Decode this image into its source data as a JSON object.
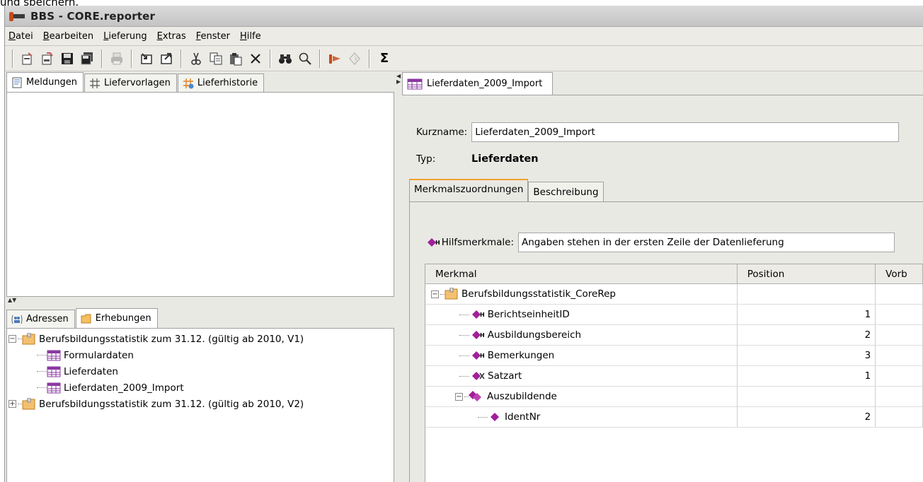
{
  "page": {
    "top_caption": "und speichern."
  },
  "window": {
    "title": "BBS - CORE.reporter"
  },
  "menu": [
    {
      "u": "D",
      "rest": "atei"
    },
    {
      "u": "B",
      "rest": "earbeiten"
    },
    {
      "u": "L",
      "rest": "ieferung"
    },
    {
      "u": "E",
      "rest": "xtras"
    },
    {
      "u": "F",
      "rest": "enster"
    },
    {
      "u": "H",
      "rest": "ilfe"
    }
  ],
  "toolbar": {
    "sigma": "Σ",
    "icons": [
      "new-icon",
      "open-icon",
      "save-icon",
      "save-all-icon",
      "print-icon",
      "import-icon",
      "export-icon",
      "cut-icon",
      "copy-icon",
      "paste-icon",
      "delete-icon",
      "binoculars-icon",
      "search-icon",
      "send-icon",
      "validate-icon",
      "sum-icon"
    ]
  },
  "left_tabs": [
    {
      "label": "Meldungen",
      "icon": "document-icon"
    },
    {
      "label": "Liefervorlagen",
      "icon": "template-icon"
    },
    {
      "label": "Lieferhistorie",
      "icon": "history-icon"
    }
  ],
  "bottom_tabs": [
    {
      "label": "Adressen",
      "icon": "addresses-icon"
    },
    {
      "label": "Erhebungen",
      "icon": "folder-icon"
    }
  ],
  "tree": [
    {
      "label": "Berufsbildungsstatistik zum 31.12. (gültig ab 2010, V1)",
      "expander": "−"
    },
    {
      "label": "Formulardaten"
    },
    {
      "label": "Lieferdaten"
    },
    {
      "label": "Lieferdaten_2009_Import"
    },
    {
      "label": "Berufsbildungsstatistik zum 31.12. (gültig ab 2010, V2)",
      "expander": "+"
    }
  ],
  "editor": {
    "tab_label": "Lieferdaten_2009_Import",
    "kurzname_label": "Kurzname:",
    "kurzname_value": "Lieferdaten_2009_Import",
    "typ_label": "Typ:",
    "typ_value": "Lieferdaten",
    "inner_tabs": [
      "Merkmalszuordnungen",
      "Beschreibung"
    ],
    "hilfs_label": "Hilfsmerkmale:",
    "hilfs_value": "Angaben stehen in der ersten Zeile der Datenlieferung",
    "h_sub": "H"
  },
  "table": {
    "headers": [
      "Merkmal",
      "Position",
      "Vorb"
    ],
    "rows": [
      {
        "label": "Berufsbildungsstatistik_CoreRep",
        "pos": "",
        "icon": "folder-icon",
        "expander": "−"
      },
      {
        "label": "BerichtseinheitID",
        "pos": "1",
        "icon": "hilfsmerkmal-icon"
      },
      {
        "label": "Ausbildungsbereich",
        "pos": "2",
        "icon": "hilfsmerkmal-icon"
      },
      {
        "label": "Bemerkungen",
        "pos": "3",
        "icon": "hilfsmerkmal-icon"
      },
      {
        "label": "Satzart",
        "pos": "1",
        "icon": "satzart-icon"
      },
      {
        "label": "Auszubildende",
        "pos": "",
        "icon": "group-icon",
        "expander": "−"
      },
      {
        "label": "IdentNr",
        "pos": "2",
        "icon": "merkmal-icon"
      }
    ]
  }
}
